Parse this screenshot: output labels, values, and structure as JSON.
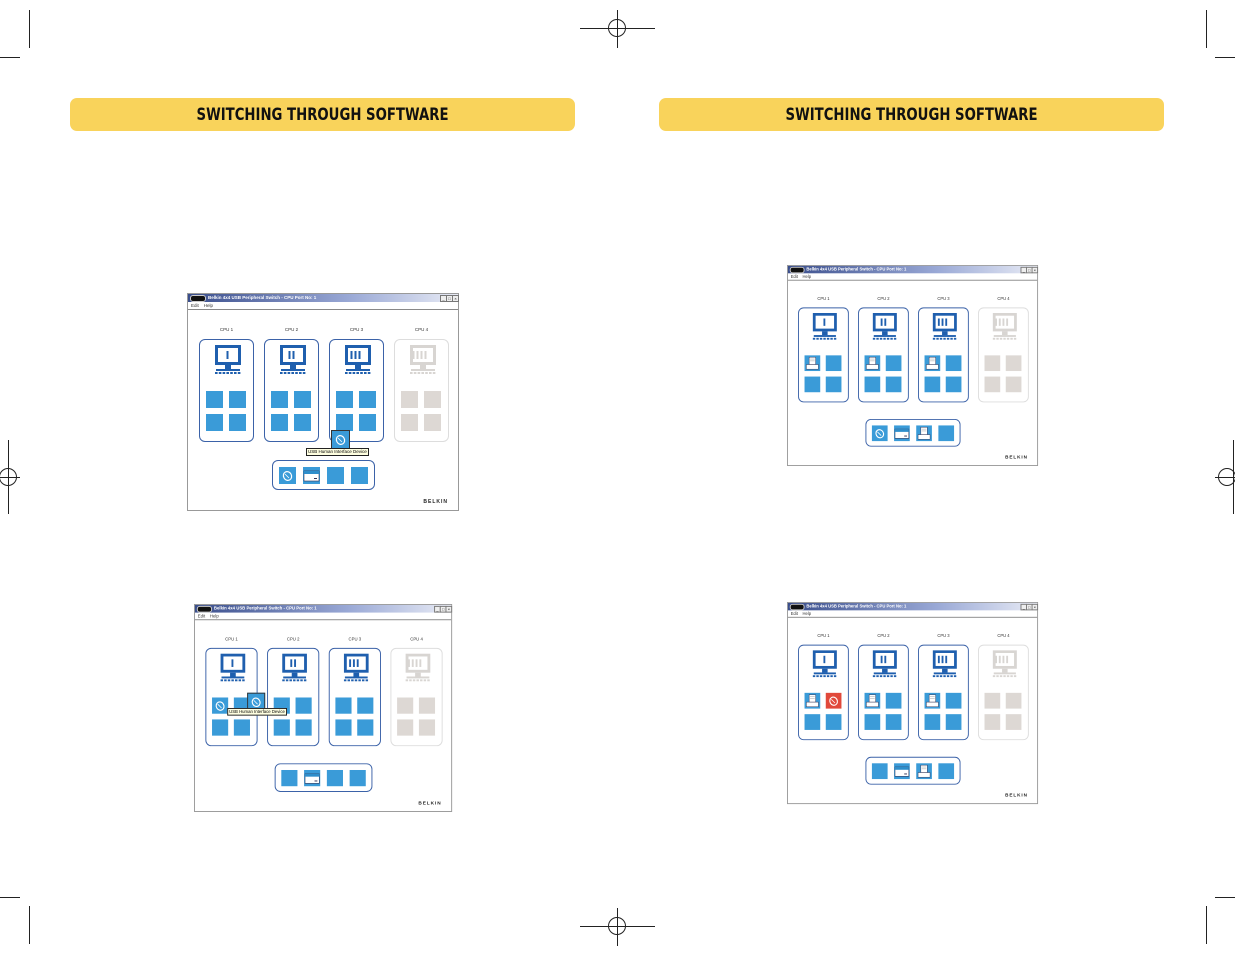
{
  "banners": [
    "SWITCHING THROUGH SOFTWARE",
    "SWITCHING THROUGH SOFTWARE"
  ],
  "colors": {
    "banner": "#f9d35b",
    "port_active": "#3a9bd8",
    "port_inactive": "#ddd8d4",
    "port_alert": "#e1493b",
    "cpu_border": "#3b62a8"
  },
  "app": {
    "title": "Belkin 4x4 USB Peripheral Switch - CPU Port No: 1",
    "menu": [
      "Edit",
      "Help"
    ],
    "cpu_labels": [
      "CPU 1",
      "CPU 2",
      "CPU 3",
      "CPU 4"
    ],
    "brand": "BELKIN"
  },
  "windows": [
    {
      "cpus": [
        [
          "blank",
          "blank",
          "blank",
          "blank"
        ],
        [
          "blank",
          "blank",
          "blank",
          "blank"
        ],
        [
          "blank",
          "blank",
          "blank",
          "blank"
        ],
        [
          "off",
          "off",
          "off",
          "off"
        ]
      ],
      "hub": [
        "mouse",
        "scanner",
        "blank",
        "blank"
      ],
      "drag": {
        "icon": "mouse",
        "near": "cpu3"
      },
      "tooltip": "USB Human Interface Device"
    },
    {
      "cpus": [
        [
          "mouse",
          "blank",
          "blank",
          "blank"
        ],
        [
          "blank",
          "blank",
          "blank",
          "blank"
        ],
        [
          "blank",
          "blank",
          "blank",
          "blank"
        ],
        [
          "off",
          "off",
          "off",
          "off"
        ]
      ],
      "hub": [
        "blank",
        "scanner",
        "blank",
        "blank"
      ],
      "drag": {
        "icon": "mouse",
        "near": "cpu1"
      },
      "tooltip": "USB Human Interface Device"
    },
    {
      "cpus": [
        [
          "printer",
          "blank",
          "blank",
          "blank"
        ],
        [
          "printer",
          "blank",
          "blank",
          "blank"
        ],
        [
          "printer",
          "blank",
          "blank",
          "blank"
        ],
        [
          "off",
          "off",
          "off",
          "off"
        ]
      ],
      "hub": [
        "mouse",
        "scanner",
        "printer",
        "blank"
      ]
    },
    {
      "cpus": [
        [
          "printer",
          "mouse-red",
          "blank",
          "blank"
        ],
        [
          "printer",
          "blank",
          "blank",
          "blank"
        ],
        [
          "printer",
          "blank",
          "blank",
          "blank"
        ],
        [
          "off",
          "off",
          "off",
          "off"
        ]
      ],
      "hub": [
        "blank",
        "scanner",
        "printer",
        "blank"
      ]
    }
  ]
}
